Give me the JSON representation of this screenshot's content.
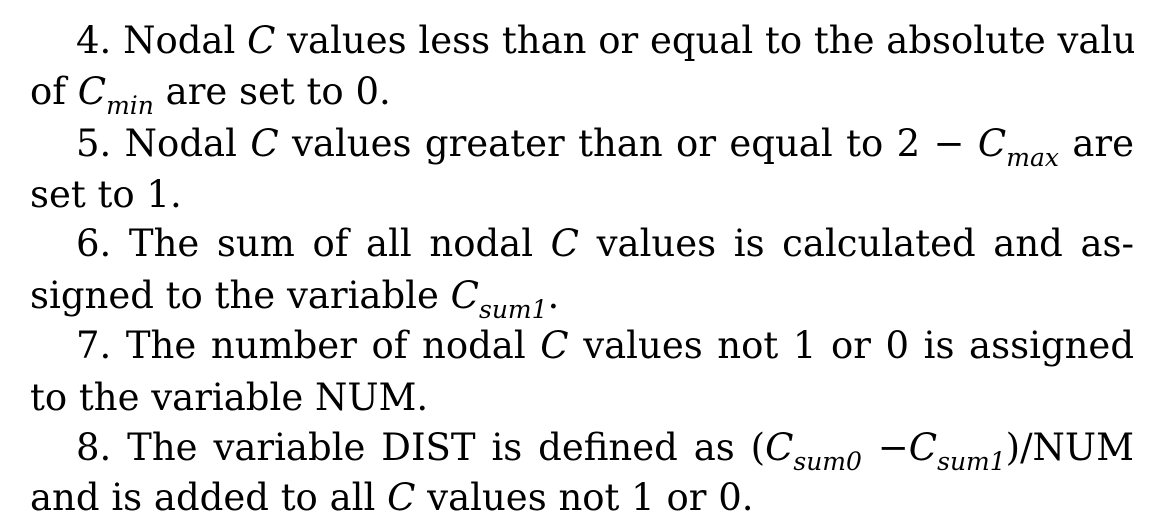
{
  "items": [
    {
      "lead": "4. Nodal",
      "sym1": "C",
      "middle": "values less than or equal to the absolute value",
      "cont_pre": "of",
      "sym2": "C",
      "sym2_sub": "min",
      "cont_post": "are set to 0."
    },
    {
      "lead": "5. Nodal",
      "sym1": "C",
      "middle": "values greater than or equal to 2 −",
      "sym2": "C",
      "sym2_sub": "max",
      "tail": "are",
      "cont": "set to 1."
    },
    {
      "lead": "6. The sum of all nodal",
      "sym1": "C",
      "middle": "values is calculated and as-",
      "cont_pre": "signed to the variable",
      "sym2": "C",
      "sym2_sub": "sum1",
      "cont_post": "."
    },
    {
      "lead": "7. The number of nodal",
      "sym1": "C",
      "middle": "values not 1 or 0 is assigned",
      "cont": "to the variable NUM."
    },
    {
      "lead": "8. The variable DIST is defined as (",
      "sym1": "C",
      "sym1_sub": "sum0",
      "op": " −",
      "sym2": "C",
      "sym2_sub": "sum1",
      "tail": ")/NUM",
      "cont_pre": "and is added to all",
      "sym3": "C",
      "cont_post": "values not 1 or 0."
    }
  ]
}
